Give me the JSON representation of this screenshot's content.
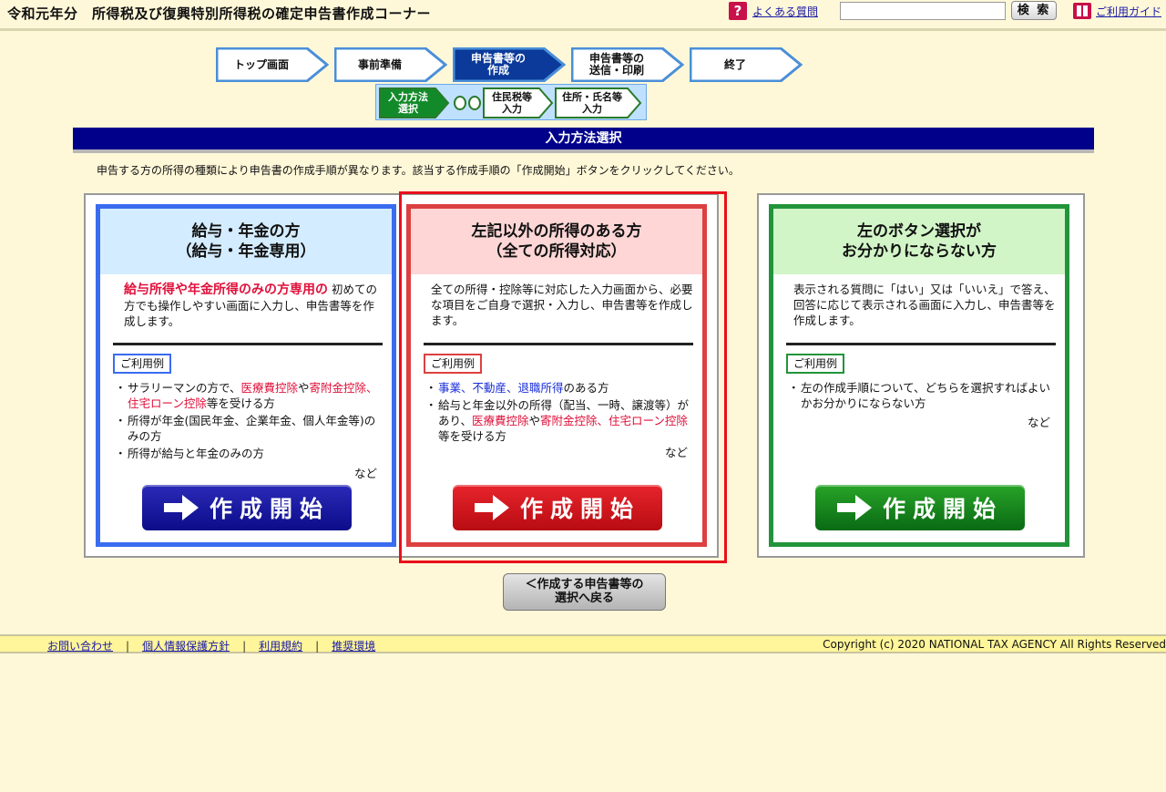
{
  "header": {
    "app_title": "令和元年分　所得税及び復興特別所得税の確定申告書作成コーナー",
    "faq_icon_text": "?",
    "faq_label": "よくある質問",
    "search_placeholder": "",
    "search_button": "検 索",
    "guide_label": "ご利用ガイド"
  },
  "steps": [
    {
      "label": "トップ画面",
      "state": "done"
    },
    {
      "label": "事前準備",
      "state": "done"
    },
    {
      "label": "申告書等の\n作成",
      "state": "active"
    },
    {
      "label": "申告書等の\n送信・印刷",
      "state": "todo"
    },
    {
      "label": "終了",
      "state": "todo"
    }
  ],
  "substeps": [
    {
      "label": "入力方法\n選択",
      "state": "active"
    },
    {
      "label": "住民税等\n入力",
      "state": "todo"
    },
    {
      "label": "住所・氏名等\n入力",
      "state": "todo"
    }
  ],
  "page_title": "入力方法選択",
  "instruction": "申告する方の所得の種類により申告書の作成手順が異なります。該当する作成手順の「作成開始」ボタンをクリックしてください。",
  "cards": {
    "salary": {
      "title": "給与・年金の方\n（給与・年金専用）",
      "desc_emph": "給与所得や年金所得のみの方専用の",
      "desc": "初めての方でも操作しやすい画面に入力し、申告書等を作成します。",
      "usage_label": "ご利用例",
      "usage_1_a": "サラリーマンの方で、",
      "usage_1_b": "医療費控除",
      "usage_1_c": "や",
      "usage_1_d": "寄附金控除、住宅ローン控除",
      "usage_1_e": "等を受ける方",
      "usage_2": "所得が年金(国民年金、企業年金、個人年金等)のみの方",
      "usage_3": "所得が給与と年金のみの方",
      "etc": "など",
      "button": "作成開始",
      "color": "#3a6cf0"
    },
    "other": {
      "title": "左記以外の所得のある方\n（全ての所得対応）",
      "desc": "全ての所得・控除等に対応した入力画面から、必要な項目をご自身で選択・入力し、申告書等を作成します。",
      "usage_label": "ご利用例",
      "usage_1_a": "事業、不動産、退職所得",
      "usage_1_b": "のある方",
      "usage_2_a": "給与と年金以外の所得（配当、一時、譲渡等）があり、",
      "usage_2_b": "医療費控除",
      "usage_2_c": "や",
      "usage_2_d": "寄附金控除、住宅ローン控除",
      "usage_2_e": "等を受ける方",
      "etc": "など",
      "button": "作成開始",
      "color": "#dd4040"
    },
    "unsure": {
      "title": "左のボタン選択が\nお分かりにならない方",
      "desc": "表示される質問に「はい」又は「いいえ」で答え、回答に応じて表示される画面に入力し、申告書等を作成します。",
      "usage_label": "ご利用例",
      "usage_1": "左の作成手順について、どちらを選択すればよいかお分かりにならない方",
      "etc": "など",
      "button": "作成開始",
      "color": "#22943a"
    }
  },
  "back_button": "＜作成する申告書等の\n選択へ戻る",
  "footer": {
    "links": [
      "お問い合わせ",
      "個人情報保護方針",
      "利用規約",
      "推奨環境"
    ],
    "copyright": "Copyright (c) 2020 NATIONAL TAX AGENCY All Rights Reserved"
  }
}
